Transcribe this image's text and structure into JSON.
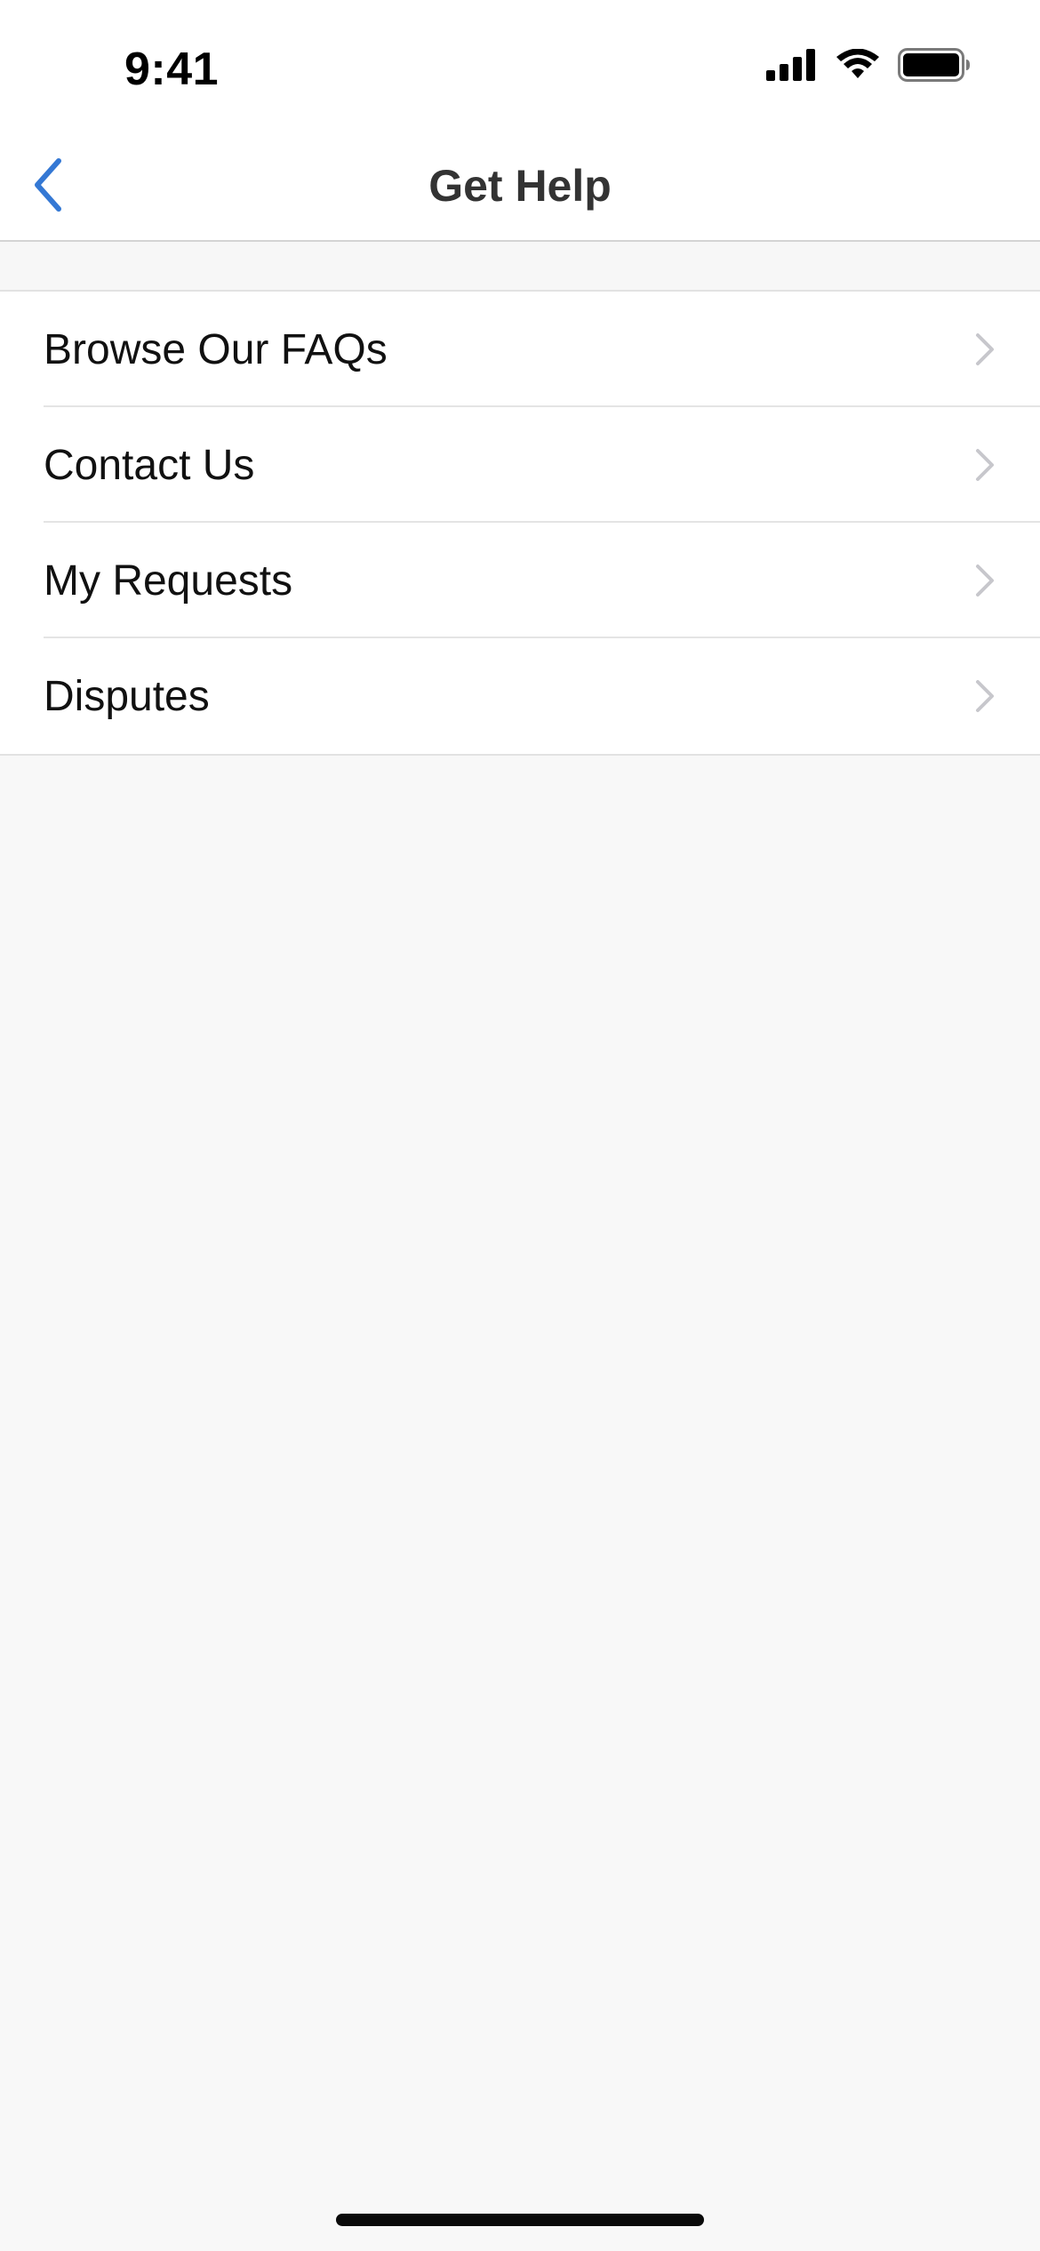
{
  "status_bar": {
    "time": "9:41",
    "icons": [
      "cellular-signal-icon",
      "wifi-icon",
      "battery-icon"
    ]
  },
  "nav": {
    "title": "Get Help",
    "back_icon": "chevron-left-icon"
  },
  "menu": {
    "items": [
      {
        "label": "Browse Our FAQs",
        "icon": "chevron-right-icon"
      },
      {
        "label": "Contact Us",
        "icon": "chevron-right-icon"
      },
      {
        "label": "My Requests",
        "icon": "chevron-right-icon"
      },
      {
        "label": "Disputes",
        "icon": "chevron-right-icon"
      }
    ]
  },
  "colors": {
    "accent": "#3478d4",
    "background": "#f8f8f8",
    "surface": "#ffffff",
    "chevron": "#c7c7cc",
    "title_text": "#333333"
  }
}
